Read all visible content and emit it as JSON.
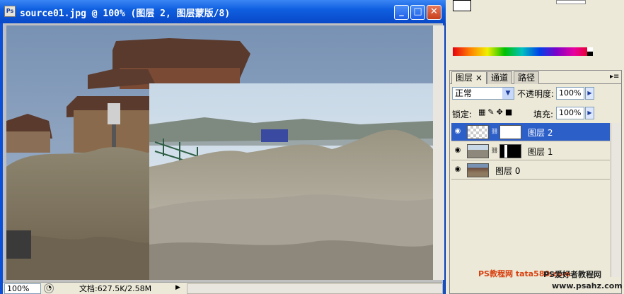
{
  "window": {
    "title": "source01.jpg @ 100% (图层 2, 图层蒙版/8)",
    "app_icon": "Ps",
    "minimize": "_",
    "maximize": "□",
    "close": "✕"
  },
  "status": {
    "zoom": "100%",
    "doc_info": "文档:627.5K/2.58M",
    "menu_arrow": "▶"
  },
  "layers_panel": {
    "tabs": [
      {
        "label": "图层",
        "close": "×"
      },
      {
        "label": "通道"
      },
      {
        "label": "路径"
      }
    ],
    "blend_mode": "正常",
    "opacity_label": "不透明度:",
    "opacity_value": "100%",
    "lock_label": "锁定:",
    "fill_label": "填充:",
    "fill_value": "100%",
    "layers": [
      {
        "name": "图层 2",
        "selected": true,
        "has_mask": true
      },
      {
        "name": "图层 1",
        "selected": false,
        "has_mask": true
      },
      {
        "name": "图层 0",
        "selected": false,
        "has_mask": false
      }
    ]
  },
  "watermark": {
    "line1": "PS教程网 tata580.com",
    "line2": "PS爱好者教程网",
    "line3": "www.psahz.com"
  },
  "colors": {
    "titlebar": "#0a50d8",
    "selection": "#2d5fc8"
  }
}
